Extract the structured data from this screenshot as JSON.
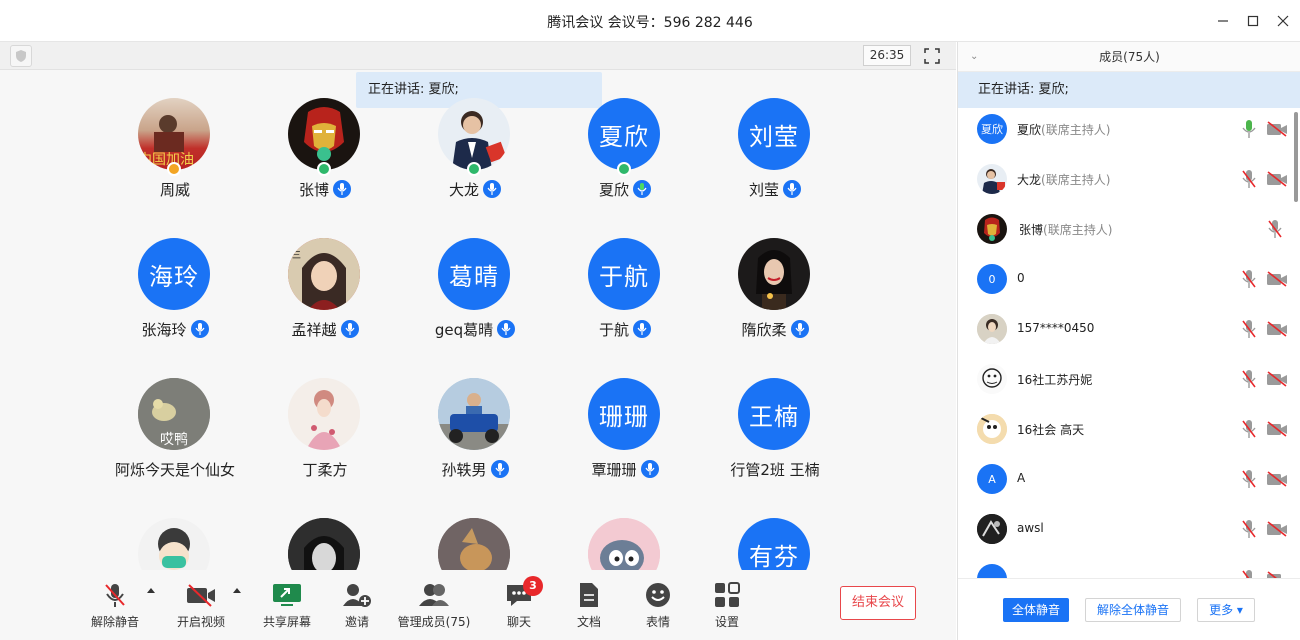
{
  "window": {
    "title": "腾讯会议 会议号：596 282 446"
  },
  "main": {
    "timer": "26:35",
    "speaking_banner": "正在讲话: 夏欣;",
    "participants": [
      {
        "name": "周威",
        "avatar": "photo-red-flag",
        "avatar_text": "",
        "mic": false,
        "host_badge": "orange"
      },
      {
        "name": "张博",
        "avatar": "photo-ironman",
        "avatar_text": "",
        "mic": true,
        "host_badge": "green"
      },
      {
        "name": "大龙",
        "avatar": "photo-man-suit",
        "avatar_text": "",
        "mic": true,
        "host_badge": "green"
      },
      {
        "name": "夏欣",
        "avatar": "blue-initials",
        "avatar_text": "夏欣",
        "mic": true,
        "mic_active": true,
        "host_badge": "green"
      },
      {
        "name": "刘莹",
        "avatar": "blue-initials",
        "avatar_text": "刘莹",
        "mic": true
      },
      {
        "name": "张海玲",
        "avatar": "blue-initials",
        "avatar_text": "海玲",
        "mic": true
      },
      {
        "name": "孟祥越",
        "avatar": "photo-anime-girl",
        "avatar_text": "",
        "mic": true
      },
      {
        "name": "geq葛晴",
        "avatar": "blue-initials",
        "avatar_text": "葛晴",
        "mic": true
      },
      {
        "name": "于航",
        "avatar": "blue-initials",
        "avatar_text": "于航",
        "mic": true
      },
      {
        "name": "隋欣柔",
        "avatar": "photo-girl-dark",
        "avatar_text": "",
        "mic": true
      },
      {
        "name": "阿烁今天是个仙女",
        "avatar": "photo-duck",
        "avatar_text": "哎鸭",
        "mic": false
      },
      {
        "name": "丁柔方",
        "avatar": "photo-girl-flowers",
        "avatar_text": "",
        "mic": false
      },
      {
        "name": "孙轶男",
        "avatar": "photo-motorcycle",
        "avatar_text": "",
        "mic": true
      },
      {
        "name": "覃珊珊",
        "avatar": "blue-initials",
        "avatar_text": "珊珊",
        "mic": true
      },
      {
        "name": "行管2班 王楠",
        "avatar": "blue-initials",
        "avatar_text": "王楠",
        "mic": false
      },
      {
        "name": "",
        "avatar": "photo-cartoon-mask",
        "avatar_text": "",
        "mic": false
      },
      {
        "name": "",
        "avatar": "photo-bw-woman",
        "avatar_text": "",
        "mic": false
      },
      {
        "name": "",
        "avatar": "photo-dog",
        "avatar_text": "",
        "mic": false
      },
      {
        "name": "",
        "avatar": "photo-tom-cat",
        "avatar_text": "",
        "mic": false
      },
      {
        "name": "",
        "avatar": "blue-initials",
        "avatar_text": "有芬",
        "mic": false
      }
    ]
  },
  "toolbar": {
    "unmute": "解除静音",
    "start_video": "开启视频",
    "share_screen": "共享屏幕",
    "invite": "邀请",
    "manage_members": "管理成员(75)",
    "chat": "聊天",
    "chat_badge": "3",
    "docs": "文档",
    "reactions": "表情",
    "settings": "设置",
    "end_meeting": "结束会议"
  },
  "panel": {
    "header": "成员(75人)",
    "speaking": "正在讲话: 夏欣;",
    "members": [
      {
        "name": "夏欣",
        "role": "(联席主持人)",
        "avatar": "blue",
        "avatar_text": "夏欣",
        "mic_on": true,
        "show_cam": true
      },
      {
        "name": "大龙",
        "role": "(联席主持人)",
        "avatar": "photo-man-suit",
        "avatar_text": "",
        "mic_on": false,
        "show_cam": true
      },
      {
        "name": "张博",
        "role": "(联席主持人)",
        "avatar": "photo-ironman",
        "avatar_text": "",
        "mic_on": false,
        "show_cam": false
      },
      {
        "name": "0",
        "role": "",
        "avatar": "blue",
        "avatar_text": "0",
        "mic_on": false,
        "show_cam": true
      },
      {
        "name": "157****0450",
        "role": "",
        "avatar": "photo-girl-doll",
        "avatar_text": "",
        "mic_on": false,
        "show_cam": true
      },
      {
        "name": "16社工苏丹妮",
        "role": "",
        "avatar": "photo-sketch",
        "avatar_text": "",
        "mic_on": false,
        "show_cam": true
      },
      {
        "name": "16社会  高天",
        "role": "",
        "avatar": "photo-cartoon",
        "avatar_text": "",
        "mic_on": false,
        "show_cam": true
      },
      {
        "name": "A",
        "role": "",
        "avatar": "blue",
        "avatar_text": "A",
        "mic_on": false,
        "show_cam": true
      },
      {
        "name": "awsl",
        "role": "",
        "avatar": "photo-dark",
        "avatar_text": "",
        "mic_on": false,
        "show_cam": true
      },
      {
        "name": "",
        "role": "",
        "avatar": "blue",
        "avatar_text": "",
        "mic_on": false,
        "show_cam": true
      }
    ],
    "mute_all": "全体静音",
    "unmute_all": "解除全体静音",
    "more": "更多 ▾"
  },
  "colors": {
    "accent": "#1a73f5",
    "banner": "#dceaf9",
    "danger": "#e8474b",
    "badge": "#e8282b"
  }
}
